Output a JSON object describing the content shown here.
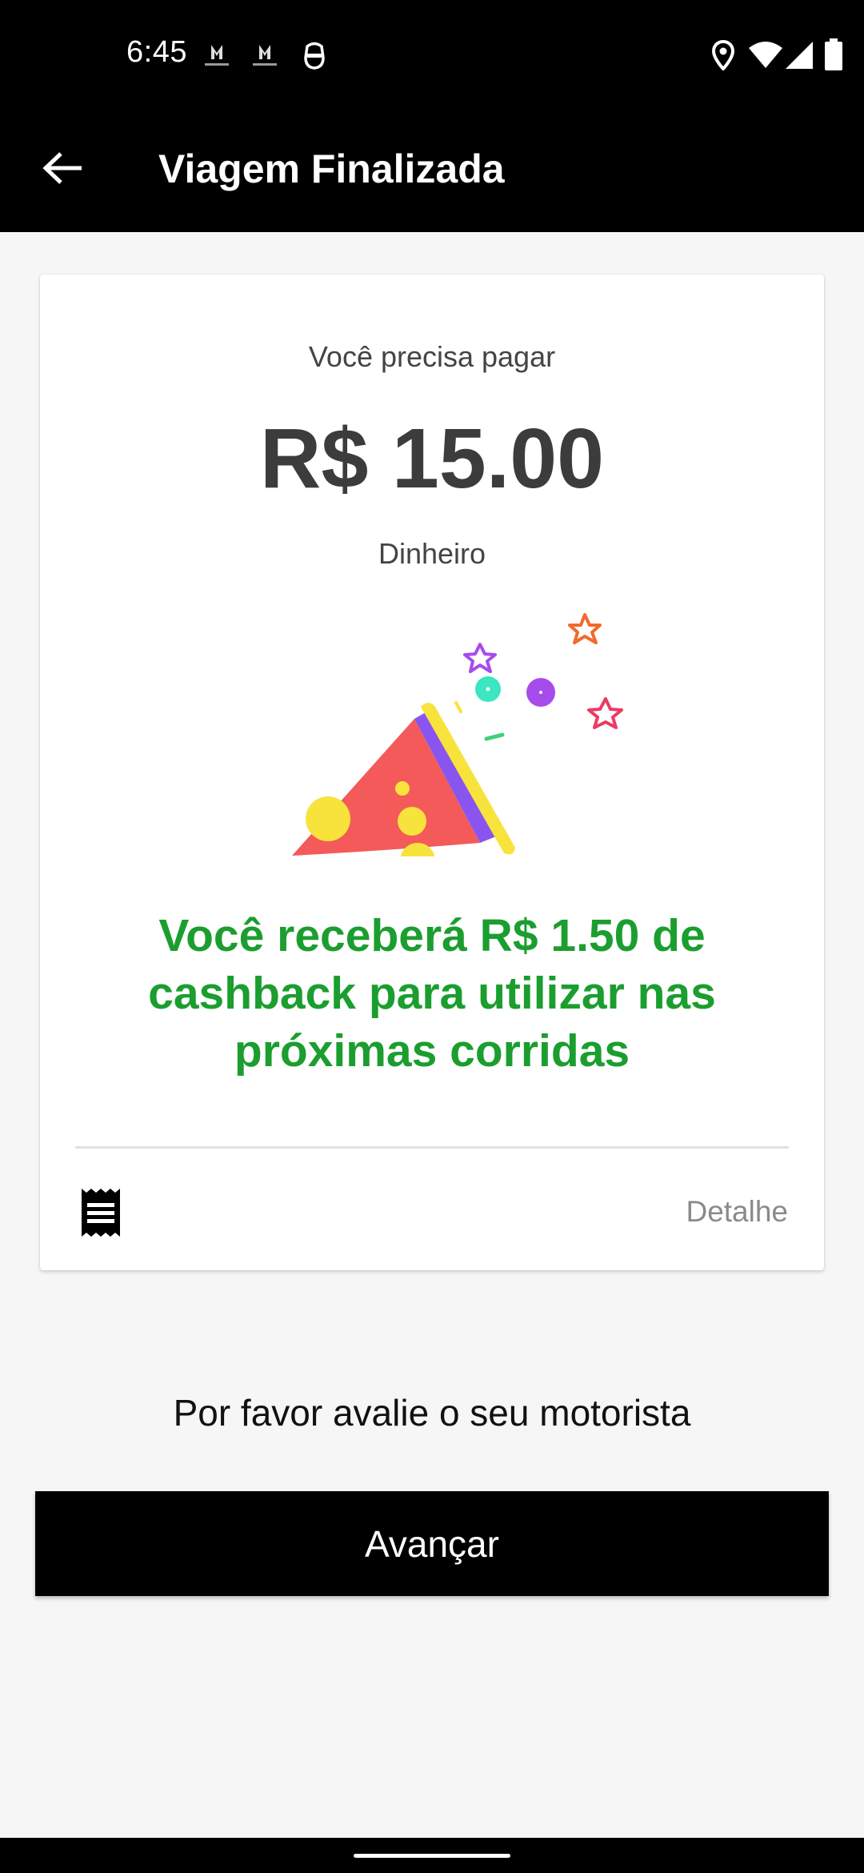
{
  "status_bar": {
    "time": "6:45",
    "notification_icons": [
      "clickdrive-notification-icon",
      "clickdrive-notification-icon",
      "robot-face-icon"
    ],
    "right_icons": [
      "location-pin-icon",
      "wifi-icon",
      "cell-signal-icon",
      "battery-icon"
    ]
  },
  "app_bar": {
    "title": "Viagem Finalizada",
    "back_icon": "arrow-left-icon"
  },
  "payment_card": {
    "pay_label": "Você precisa pagar",
    "amount": "R$ 15.00",
    "method": "Dinheiro",
    "illustration": "party-popper-icon",
    "cashback_message": "Você receberá R$ 1.50 de cashback para utilizar nas próximas corridas",
    "receipt_icon": "receipt-icon",
    "detail_label": "Detalhe"
  },
  "rating": {
    "prompt": "Por favor avalie o seu motorista"
  },
  "actions": {
    "advance_label": "Avançar"
  },
  "colors": {
    "app_bar_bg": "#000000",
    "background": "#f7f6f7",
    "cashback_green": "#1b9e2f",
    "amount_text": "#3c3c3c",
    "button_bg": "#000000"
  }
}
